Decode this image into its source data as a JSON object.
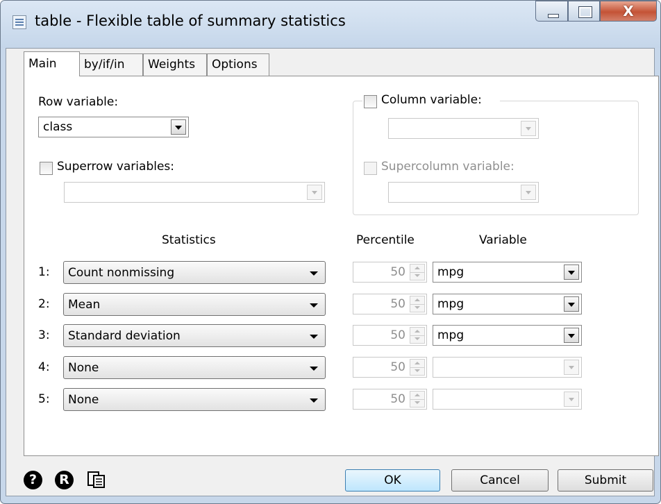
{
  "window": {
    "title": "table - Flexible table of summary statistics",
    "close_glyph": "X"
  },
  "tabs": [
    {
      "label": "Main",
      "selected": true
    },
    {
      "label": "by/if/in",
      "selected": false
    },
    {
      "label": "Weights",
      "selected": false
    },
    {
      "label": "Options",
      "selected": false
    }
  ],
  "row_variable": {
    "label": "Row variable:",
    "value": "class"
  },
  "superrow": {
    "label": "Superrow variables:",
    "checked": false,
    "value": ""
  },
  "column_variable": {
    "label": "Column variable:",
    "checked": false,
    "value": ""
  },
  "supercolumn": {
    "label": "Supercolumn variable:",
    "checked": false,
    "value": ""
  },
  "headers": {
    "statistics": "Statistics",
    "percentile": "Percentile",
    "variable": "Variable"
  },
  "stats": [
    {
      "index": "1:",
      "statistic": "Count nonmissing",
      "percentile": "50",
      "variable": "mpg",
      "variable_enabled": true
    },
    {
      "index": "2:",
      "statistic": "Mean",
      "percentile": "50",
      "variable": "mpg",
      "variable_enabled": true
    },
    {
      "index": "3:",
      "statistic": "Standard deviation",
      "percentile": "50",
      "variable": "mpg",
      "variable_enabled": true
    },
    {
      "index": "4:",
      "statistic": "None",
      "percentile": "50",
      "variable": "",
      "variable_enabled": false
    },
    {
      "index": "5:",
      "statistic": "None",
      "percentile": "50",
      "variable": "",
      "variable_enabled": false
    }
  ],
  "footer": {
    "help_icon": "?",
    "reset_icon": "R",
    "ok_label": "OK",
    "cancel_label": "Cancel",
    "submit_label": "Submit"
  },
  "colors": {
    "ok_accent": "#3c7fb1",
    "close_button": "#c45336"
  }
}
